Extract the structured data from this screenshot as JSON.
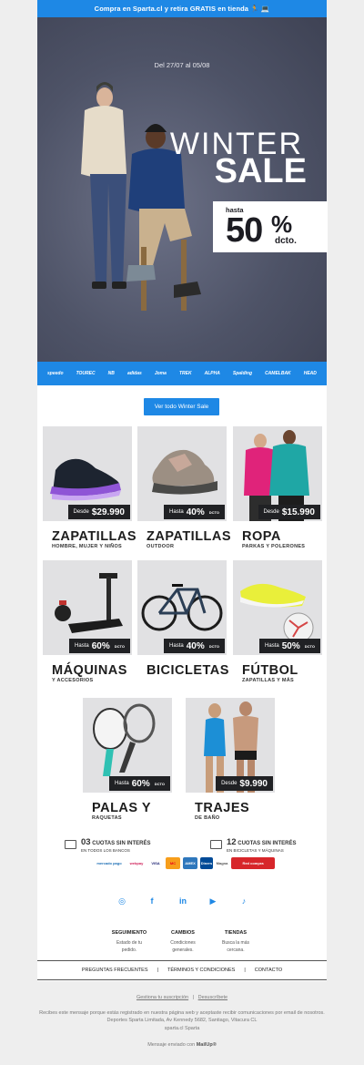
{
  "topbar": {
    "text": "Compra en Sparta.cl y retira GRATIS en tienda 🏃 💻"
  },
  "hero": {
    "date": "Del 27/07 al 05/08",
    "title_line1": "WINTER",
    "title_line2": "SALE",
    "badge_hasta": "hasta",
    "badge_number": "50",
    "badge_percent": "%",
    "badge_dcto": "dcto."
  },
  "brands": [
    "speedo",
    "TOUREC",
    "NB",
    "adidas",
    "Joma",
    "TREK",
    "ALPHA",
    "Spalding",
    "CAMELBAK",
    "HEAD"
  ],
  "cta": {
    "label": "Ver todo Winter Sale"
  },
  "products": [
    {
      "title": "ZAPATILLAS",
      "subtitle": "HOMBRE, MUJER Y NIÑOS",
      "prefix": "Desde",
      "value": "$29.990",
      "suffix": ""
    },
    {
      "title": "ZAPATILLAS",
      "subtitle": "OUTDOOR",
      "prefix": "Hasta",
      "value": "40%",
      "suffix": "DCTO"
    },
    {
      "title": "ROPA",
      "subtitle": "PARKAS Y POLERONES",
      "prefix": "Desde",
      "value": "$15.990",
      "suffix": ""
    },
    {
      "title": "MÁQUINAS",
      "subtitle": "Y ACCESORIOS",
      "prefix": "Hasta",
      "value": "60%",
      "suffix": "DCTO"
    },
    {
      "title": "BICICLETAS",
      "subtitle": "",
      "prefix": "Hasta",
      "value": "40%",
      "suffix": "DCTO"
    },
    {
      "title": "FÚTBOL",
      "subtitle": "ZAPATILLAS Y MÁS",
      "prefix": "Hasta",
      "value": "50%",
      "suffix": "DCTO"
    },
    {
      "title": "PALAS Y",
      "subtitle": "RAQUETAS",
      "prefix": "Hasta",
      "value": "60%",
      "suffix": "DCTO"
    },
    {
      "title": "TRAJES",
      "subtitle": "DE BAÑO",
      "prefix": "Desde",
      "value": "$9.990",
      "suffix": ""
    }
  ],
  "cuotas": [
    {
      "num": "03",
      "label": "CUOTAS SIN INTERÉS",
      "detail": "EN TODOS LOS BANCOS"
    },
    {
      "num": "12",
      "label": "CUOTAS SIN INTERÉS",
      "detail": "EN BICICLETAS Y MÁQUINAS"
    }
  ],
  "payments": [
    "mercado pago",
    "webpay",
    "VISA",
    "MC",
    "AMEX",
    "Diners",
    "Magna",
    "Red compra"
  ],
  "social": [
    "instagram-icon",
    "facebook-icon",
    "linkedin-icon",
    "youtube-icon",
    "tiktok-icon"
  ],
  "footer_cols": [
    {
      "title": "SEGUIMIENTO",
      "line1": "Estado de tu",
      "line2": "pedido."
    },
    {
      "title": "CAMBIOS",
      "line1": "Condiciones",
      "line2": "generales."
    },
    {
      "title": "TIENDAS",
      "line1": "Busca la más",
      "line2": "cercana."
    }
  ],
  "links": [
    "PREGUNTAS FRECUENTES",
    "|",
    "TÉRMINOS Y CONDICIONES",
    "|",
    "CONTACTO"
  ],
  "legal": {
    "manage": "Gestiona tu suscripción",
    "sep": "|",
    "unsubscribe": "Desuscríbete",
    "line1": "Recibes este mensaje porque estás registrado en nuestra página web y aceptaste recibir comunicaciones por email de nosotros.",
    "line2": "Deportes Sparta Limitada, Av Kennedy 5682, Santiago, Vitacura CL",
    "line3": "sparta.cl Sparta",
    "sent_by": "Mensaje enviado con",
    "sender": "MailUp®"
  },
  "colors": {
    "accent": "#1e88e5",
    "dark": "#202124",
    "card_bg": "#e1e1e3"
  }
}
